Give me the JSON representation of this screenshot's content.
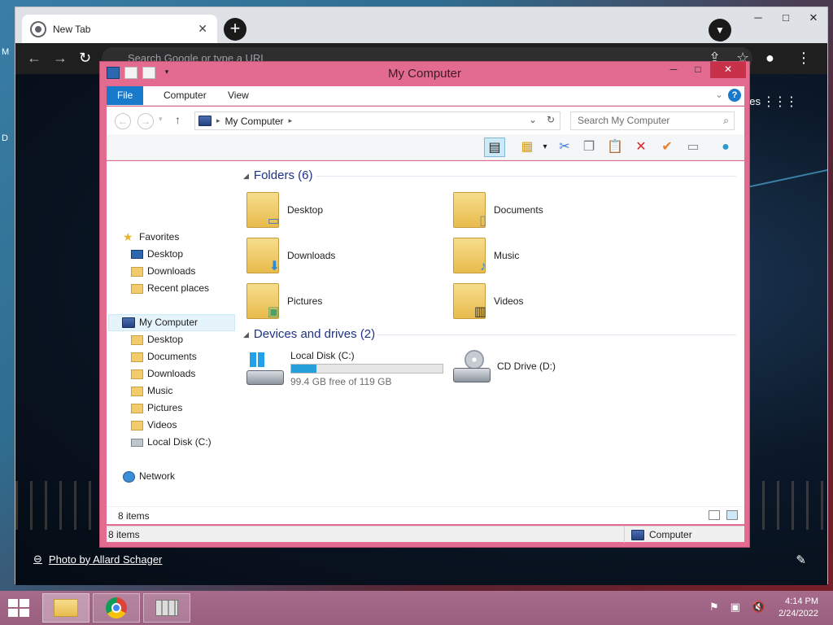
{
  "desktop": {
    "frag_top": "M",
    "frag_left": "D"
  },
  "browser": {
    "tab_title": "New Tab",
    "omnibox_placeholder": "Search Google or type a URL",
    "partial_label": "ges",
    "photo_credit": "Photo by Allard Schager"
  },
  "explorer": {
    "title": "My Computer",
    "ribbon_tabs": [
      "File",
      "Computer",
      "View"
    ],
    "address_path": "My Computer",
    "search_placeholder": "Search My Computer",
    "nav": {
      "favorites": "Favorites",
      "favorites_items": [
        "Desktop",
        "Downloads",
        "Recent places"
      ],
      "computer": "My Computer",
      "computer_items": [
        "Desktop",
        "Documents",
        "Downloads",
        "Music",
        "Pictures",
        "Videos",
        "Local Disk (C:)"
      ],
      "network": "Network"
    },
    "groups": {
      "folders_header": "Folders (6)",
      "folders": [
        "Desktop",
        "Documents",
        "Downloads",
        "Music",
        "Pictures",
        "Videos"
      ],
      "drives_header": "Devices and drives (2)",
      "drive_c": {
        "name": "Local Disk (C:)",
        "free_text": "99.4 GB free of 119 GB",
        "used_fraction": 0.165
      },
      "drive_d": {
        "name": "CD Drive (D:)"
      }
    },
    "inner_status": "8 items",
    "outer_status": "8 items",
    "outer_status_right": "Computer"
  },
  "taskbar": {
    "time": "4:14 PM",
    "date": "2/24/2022"
  }
}
